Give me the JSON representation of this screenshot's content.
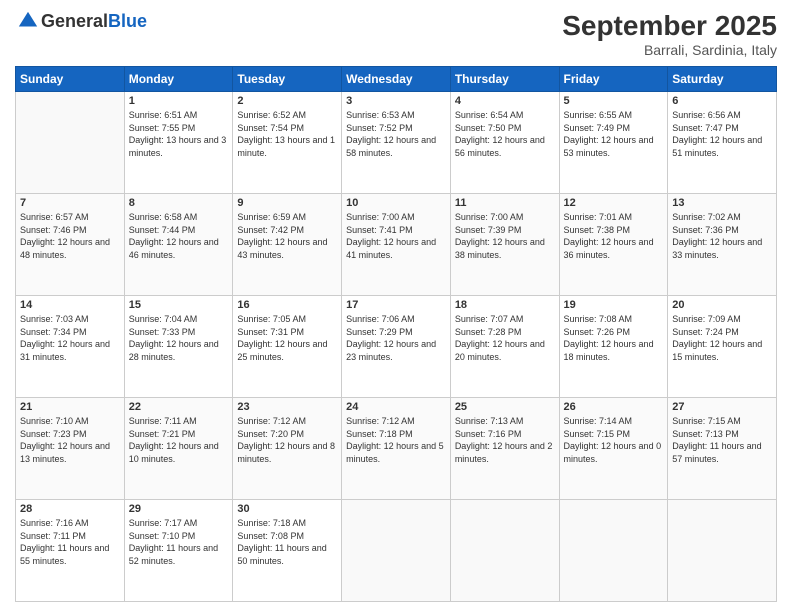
{
  "header": {
    "logo_general": "General",
    "logo_blue": "Blue",
    "month_title": "September 2025",
    "location": "Barrali, Sardinia, Italy"
  },
  "days_of_week": [
    "Sunday",
    "Monday",
    "Tuesday",
    "Wednesday",
    "Thursday",
    "Friday",
    "Saturday"
  ],
  "weeks": [
    [
      {
        "day": "",
        "sunrise": "",
        "sunset": "",
        "daylight": ""
      },
      {
        "day": "1",
        "sunrise": "Sunrise: 6:51 AM",
        "sunset": "Sunset: 7:55 PM",
        "daylight": "Daylight: 13 hours and 3 minutes."
      },
      {
        "day": "2",
        "sunrise": "Sunrise: 6:52 AM",
        "sunset": "Sunset: 7:54 PM",
        "daylight": "Daylight: 13 hours and 1 minute."
      },
      {
        "day": "3",
        "sunrise": "Sunrise: 6:53 AM",
        "sunset": "Sunset: 7:52 PM",
        "daylight": "Daylight: 12 hours and 58 minutes."
      },
      {
        "day": "4",
        "sunrise": "Sunrise: 6:54 AM",
        "sunset": "Sunset: 7:50 PM",
        "daylight": "Daylight: 12 hours and 56 minutes."
      },
      {
        "day": "5",
        "sunrise": "Sunrise: 6:55 AM",
        "sunset": "Sunset: 7:49 PM",
        "daylight": "Daylight: 12 hours and 53 minutes."
      },
      {
        "day": "6",
        "sunrise": "Sunrise: 6:56 AM",
        "sunset": "Sunset: 7:47 PM",
        "daylight": "Daylight: 12 hours and 51 minutes."
      }
    ],
    [
      {
        "day": "7",
        "sunrise": "Sunrise: 6:57 AM",
        "sunset": "Sunset: 7:46 PM",
        "daylight": "Daylight: 12 hours and 48 minutes."
      },
      {
        "day": "8",
        "sunrise": "Sunrise: 6:58 AM",
        "sunset": "Sunset: 7:44 PM",
        "daylight": "Daylight: 12 hours and 46 minutes."
      },
      {
        "day": "9",
        "sunrise": "Sunrise: 6:59 AM",
        "sunset": "Sunset: 7:42 PM",
        "daylight": "Daylight: 12 hours and 43 minutes."
      },
      {
        "day": "10",
        "sunrise": "Sunrise: 7:00 AM",
        "sunset": "Sunset: 7:41 PM",
        "daylight": "Daylight: 12 hours and 41 minutes."
      },
      {
        "day": "11",
        "sunrise": "Sunrise: 7:00 AM",
        "sunset": "Sunset: 7:39 PM",
        "daylight": "Daylight: 12 hours and 38 minutes."
      },
      {
        "day": "12",
        "sunrise": "Sunrise: 7:01 AM",
        "sunset": "Sunset: 7:38 PM",
        "daylight": "Daylight: 12 hours and 36 minutes."
      },
      {
        "day": "13",
        "sunrise": "Sunrise: 7:02 AM",
        "sunset": "Sunset: 7:36 PM",
        "daylight": "Daylight: 12 hours and 33 minutes."
      }
    ],
    [
      {
        "day": "14",
        "sunrise": "Sunrise: 7:03 AM",
        "sunset": "Sunset: 7:34 PM",
        "daylight": "Daylight: 12 hours and 31 minutes."
      },
      {
        "day": "15",
        "sunrise": "Sunrise: 7:04 AM",
        "sunset": "Sunset: 7:33 PM",
        "daylight": "Daylight: 12 hours and 28 minutes."
      },
      {
        "day": "16",
        "sunrise": "Sunrise: 7:05 AM",
        "sunset": "Sunset: 7:31 PM",
        "daylight": "Daylight: 12 hours and 25 minutes."
      },
      {
        "day": "17",
        "sunrise": "Sunrise: 7:06 AM",
        "sunset": "Sunset: 7:29 PM",
        "daylight": "Daylight: 12 hours and 23 minutes."
      },
      {
        "day": "18",
        "sunrise": "Sunrise: 7:07 AM",
        "sunset": "Sunset: 7:28 PM",
        "daylight": "Daylight: 12 hours and 20 minutes."
      },
      {
        "day": "19",
        "sunrise": "Sunrise: 7:08 AM",
        "sunset": "Sunset: 7:26 PM",
        "daylight": "Daylight: 12 hours and 18 minutes."
      },
      {
        "day": "20",
        "sunrise": "Sunrise: 7:09 AM",
        "sunset": "Sunset: 7:24 PM",
        "daylight": "Daylight: 12 hours and 15 minutes."
      }
    ],
    [
      {
        "day": "21",
        "sunrise": "Sunrise: 7:10 AM",
        "sunset": "Sunset: 7:23 PM",
        "daylight": "Daylight: 12 hours and 13 minutes."
      },
      {
        "day": "22",
        "sunrise": "Sunrise: 7:11 AM",
        "sunset": "Sunset: 7:21 PM",
        "daylight": "Daylight: 12 hours and 10 minutes."
      },
      {
        "day": "23",
        "sunrise": "Sunrise: 7:12 AM",
        "sunset": "Sunset: 7:20 PM",
        "daylight": "Daylight: 12 hours and 8 minutes."
      },
      {
        "day": "24",
        "sunrise": "Sunrise: 7:12 AM",
        "sunset": "Sunset: 7:18 PM",
        "daylight": "Daylight: 12 hours and 5 minutes."
      },
      {
        "day": "25",
        "sunrise": "Sunrise: 7:13 AM",
        "sunset": "Sunset: 7:16 PM",
        "daylight": "Daylight: 12 hours and 2 minutes."
      },
      {
        "day": "26",
        "sunrise": "Sunrise: 7:14 AM",
        "sunset": "Sunset: 7:15 PM",
        "daylight": "Daylight: 12 hours and 0 minutes."
      },
      {
        "day": "27",
        "sunrise": "Sunrise: 7:15 AM",
        "sunset": "Sunset: 7:13 PM",
        "daylight": "Daylight: 11 hours and 57 minutes."
      }
    ],
    [
      {
        "day": "28",
        "sunrise": "Sunrise: 7:16 AM",
        "sunset": "Sunset: 7:11 PM",
        "daylight": "Daylight: 11 hours and 55 minutes."
      },
      {
        "day": "29",
        "sunrise": "Sunrise: 7:17 AM",
        "sunset": "Sunset: 7:10 PM",
        "daylight": "Daylight: 11 hours and 52 minutes."
      },
      {
        "day": "30",
        "sunrise": "Sunrise: 7:18 AM",
        "sunset": "Sunset: 7:08 PM",
        "daylight": "Daylight: 11 hours and 50 minutes."
      },
      {
        "day": "",
        "sunrise": "",
        "sunset": "",
        "daylight": ""
      },
      {
        "day": "",
        "sunrise": "",
        "sunset": "",
        "daylight": ""
      },
      {
        "day": "",
        "sunrise": "",
        "sunset": "",
        "daylight": ""
      },
      {
        "day": "",
        "sunrise": "",
        "sunset": "",
        "daylight": ""
      }
    ]
  ]
}
